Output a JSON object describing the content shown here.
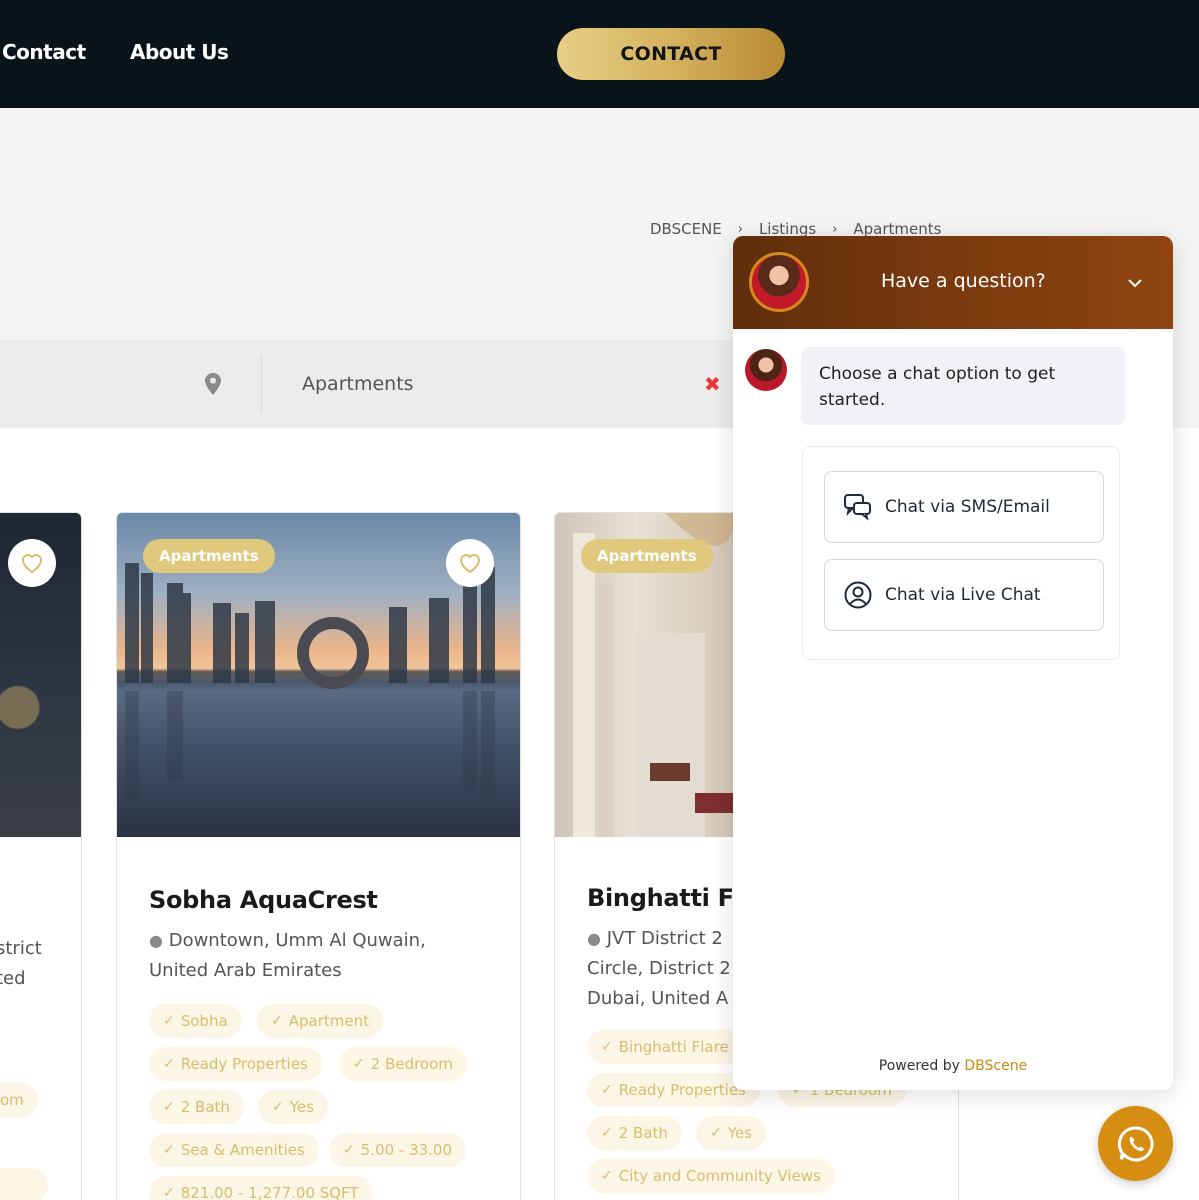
{
  "header": {
    "nav": [
      "Contact",
      "About Us"
    ],
    "cta": "CONTACT"
  },
  "breadcrumb": [
    "DBSCENE",
    "Listings",
    "Apartments"
  ],
  "search": {
    "location_icon": "map-pin-icon",
    "category_value": "Apartments",
    "clear_icon": "close-icon"
  },
  "cards": {
    "left": {
      "location_lines": [
        "strict",
        "ted"
      ],
      "tags": [
        "om"
      ]
    },
    "middle": {
      "badge": "Apartments",
      "title": "Sobha AquaCrest",
      "location_lines": [
        "Downtown, Umm Al Quwain,",
        "United Arab Emirates"
      ],
      "tags": [
        "Sobha",
        "Apartment",
        "Ready Properties",
        "2 Bedroom",
        "2 Bath",
        "Yes",
        "Sea & Amenities",
        "5.00 - 33.00",
        "821.00 - 1,277.00 SQFT"
      ]
    },
    "right": {
      "badge": "Apartments",
      "title": "Binghatti Fla",
      "location_lines": [
        "JVT District 2",
        "Circle, District 2",
        "Dubai, United A"
      ],
      "tags": [
        "Binghatti Flare",
        "Ready Properties",
        "1 Bedroom",
        "2 Bath",
        "Yes",
        "City and Community Views"
      ]
    }
  },
  "chat": {
    "title": "Have a question?",
    "message": "Choose a chat option to get started.",
    "options": [
      "Chat via SMS/Email",
      "Chat via Live Chat"
    ],
    "powered_by": "Powered by",
    "brand": "DBScene",
    "header_color": "#7a3a0e",
    "accent": "#c98a15"
  },
  "whatsapp": {
    "icon": "whatsapp-icon",
    "color": "#d58e12"
  }
}
